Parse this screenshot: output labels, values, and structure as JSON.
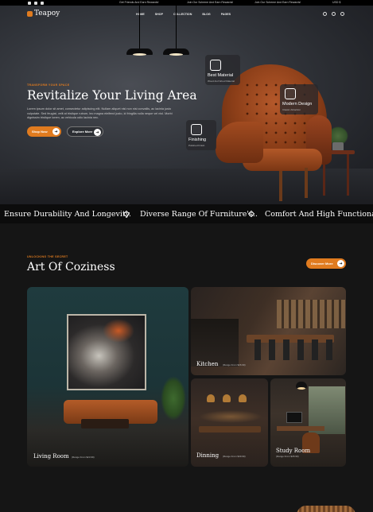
{
  "topbar": {
    "promo1": "Get Friends And Earn Rewards!",
    "promo2": "Join Our Scheme And Earn Rewards!",
    "promo3": "Join Our Scheme And Earn Rewards!",
    "currency": "USD $"
  },
  "nav": {
    "logo": "Teapoy",
    "items": [
      "HOME",
      "SHOP",
      "COLLECTION",
      "BLOG",
      "PAGES"
    ]
  },
  "hero": {
    "eyebrow": "TRANSFORM YOUR SPACE",
    "title": "Revitalize Your Living Area",
    "description": "Lorem ipsum dolor sit amet, consectetur adipiscing elit. Nullam aliquet nisl non nisi convallis, ac lacinia justo vulputate. Sed feugiat, velit at tristique rutrum, leo magna eleifend justo, id fringilla nulla neque vel nisl. Morbi dignissim tristique lorem, ac vehicula odio lacinia nec.",
    "shop_label": "Shop Now",
    "explore_label": "Explore More",
    "badges": [
      {
        "title": "Best Material",
        "sub": "Wood And Wood Material"
      },
      {
        "title": "Modern Design",
        "sub": "Classic Attraction"
      },
      {
        "title": "Finishing",
        "sub": "Polished Finish"
      }
    ]
  },
  "marquee": {
    "items": [
      "Ensure Durability And Longevity.",
      "Diverse Range Of Furniture's..",
      "Comfort And High Functionality."
    ]
  },
  "section": {
    "eyebrow": "UNLOCKING THE SECRET",
    "title": "Art Of Coziness",
    "discover_label": "Discover More",
    "cards": [
      {
        "label": "Living Room",
        "sub": "(Range From $23.99)"
      },
      {
        "label": "Kitchen",
        "sub": "(Range From $26.99)"
      },
      {
        "label": "Dinning",
        "sub": "(Range From $39.99)"
      },
      {
        "label": "Study Room",
        "sub": "(Range From $35.99)"
      }
    ]
  },
  "colors": {
    "accent": "#e07b1f",
    "background": "#151515"
  },
  "icons": [
    "facebook-icon",
    "instagram-icon",
    "whatsapp-icon",
    "search-icon",
    "user-icon",
    "heart-icon",
    "arrow-right-icon"
  ]
}
